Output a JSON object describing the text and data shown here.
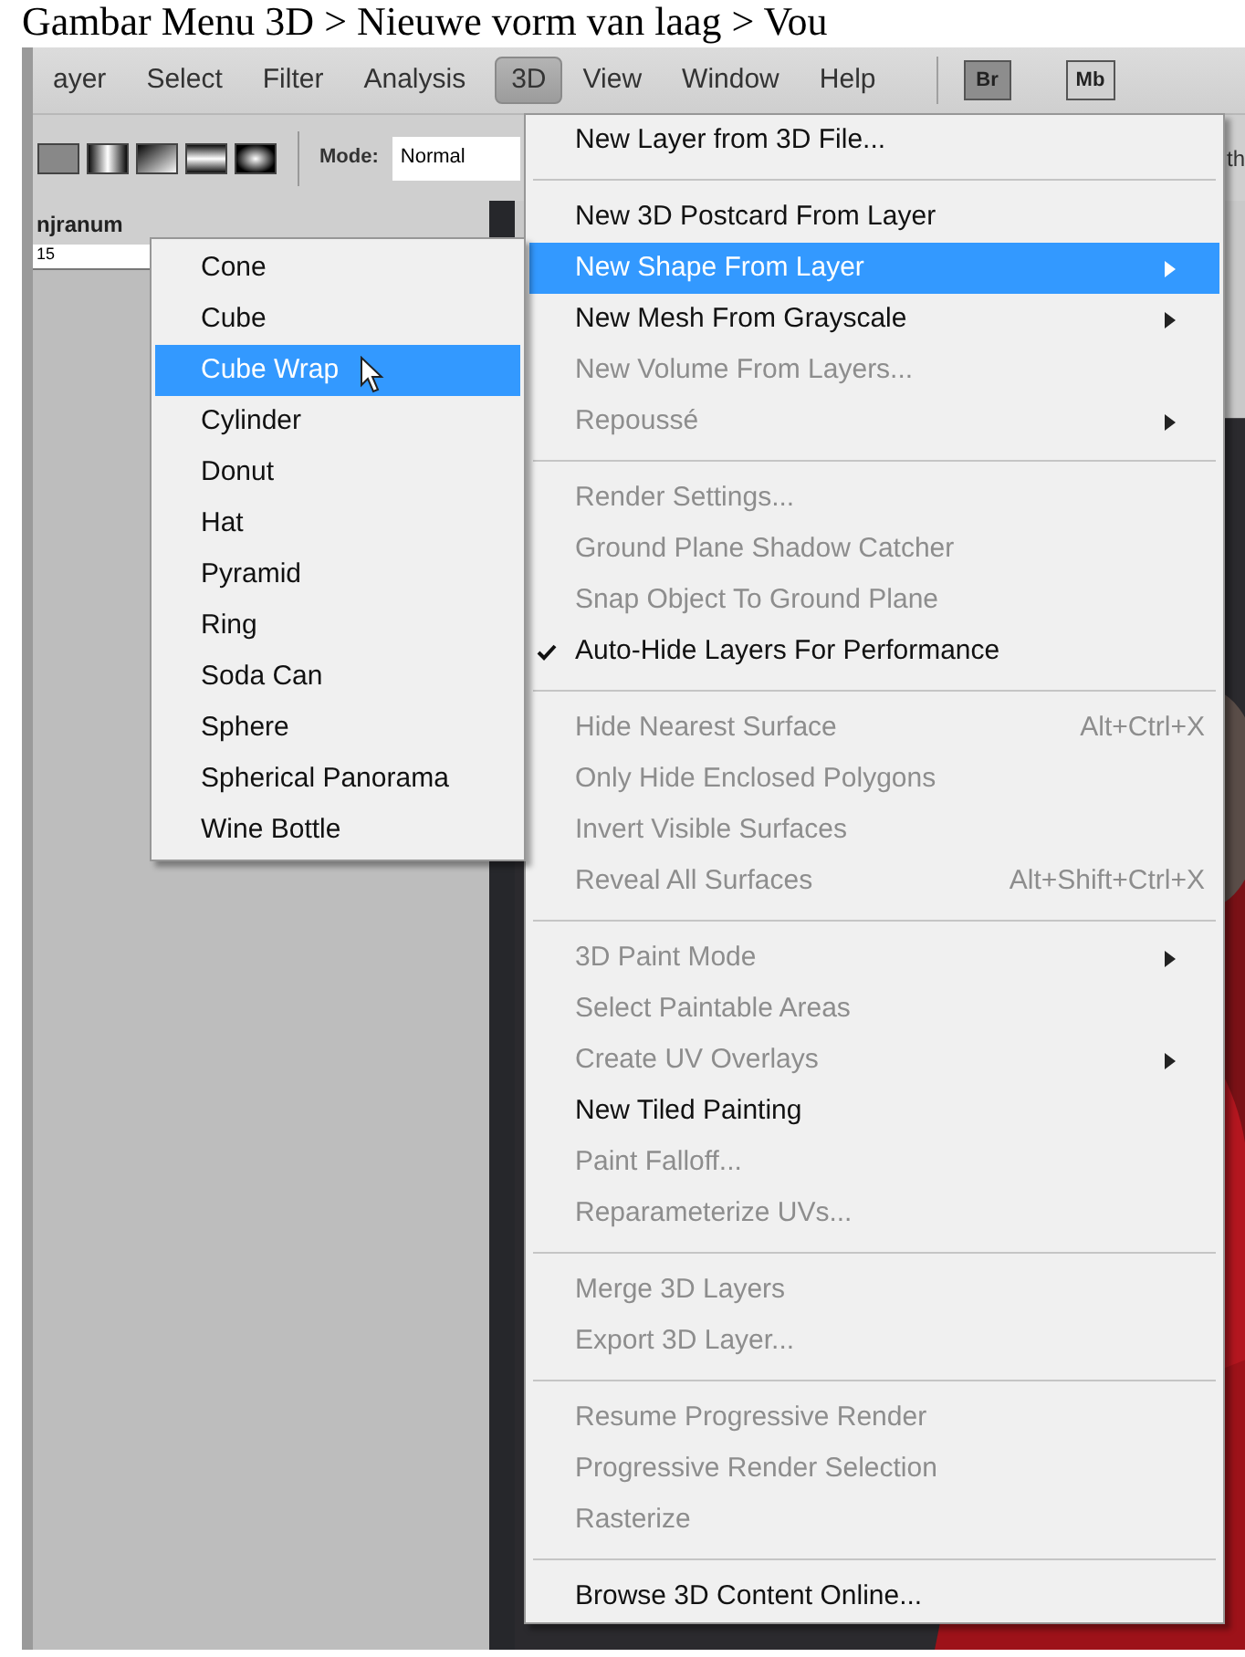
{
  "caption": "Gambar Menu 3D > Nieuwe vorm van laag > Vou",
  "menubar": [
    {
      "label": "ayer",
      "selected": false
    },
    {
      "label": "Select",
      "selected": false
    },
    {
      "label": "Filter",
      "selected": false
    },
    {
      "label": "Analysis",
      "selected": false
    },
    {
      "label": "3D",
      "selected": true
    },
    {
      "label": "View",
      "selected": false
    },
    {
      "label": "Window",
      "selected": false
    },
    {
      "label": "Help",
      "selected": false
    }
  ],
  "app_buttons": [
    "Br",
    "Mb"
  ],
  "toolbar": {
    "mode_label": "Mode:",
    "mode_value": "Normal",
    "cut_label": "th"
  },
  "document": {
    "tab": "njranum",
    "ruler": "15"
  },
  "menu": [
    {
      "kind": "item",
      "label": "New Layer from 3D File...",
      "disabled": false
    },
    {
      "kind": "separator"
    },
    {
      "kind": "item",
      "label": "New 3D Postcard From Layer",
      "disabled": false
    },
    {
      "kind": "item",
      "label": "New Shape From Layer",
      "disabled": false,
      "selected": true,
      "submenu": true
    },
    {
      "kind": "item",
      "label": "New Mesh From Grayscale",
      "disabled": false,
      "submenu": true
    },
    {
      "kind": "item",
      "label": "New Volume From Layers...",
      "disabled": true
    },
    {
      "kind": "item",
      "label": "Repoussé",
      "disabled": true,
      "submenu": true
    },
    {
      "kind": "separator"
    },
    {
      "kind": "item",
      "label": "Render Settings...",
      "disabled": true
    },
    {
      "kind": "item",
      "label": "Ground Plane Shadow Catcher",
      "disabled": true
    },
    {
      "kind": "item",
      "label": "Snap Object To Ground Plane",
      "disabled": true
    },
    {
      "kind": "item",
      "label": "Auto-Hide Layers For Performance",
      "disabled": false,
      "checked": true
    },
    {
      "kind": "separator"
    },
    {
      "kind": "item",
      "label": "Hide Nearest Surface",
      "disabled": true,
      "shortcut": "Alt+Ctrl+X"
    },
    {
      "kind": "item",
      "label": "Only Hide Enclosed Polygons",
      "disabled": true
    },
    {
      "kind": "item",
      "label": "Invert Visible Surfaces",
      "disabled": true
    },
    {
      "kind": "item",
      "label": "Reveal All Surfaces",
      "disabled": true,
      "shortcut": "Alt+Shift+Ctrl+X"
    },
    {
      "kind": "separator"
    },
    {
      "kind": "item",
      "label": "3D Paint Mode",
      "disabled": true,
      "submenu": true
    },
    {
      "kind": "item",
      "label": "Select Paintable Areas",
      "disabled": true
    },
    {
      "kind": "item",
      "label": "Create UV Overlays",
      "disabled": true,
      "submenu": true
    },
    {
      "kind": "item",
      "label": "New Tiled Painting",
      "disabled": false
    },
    {
      "kind": "item",
      "label": "Paint Falloff...",
      "disabled": true
    },
    {
      "kind": "item",
      "label": "Reparameterize UVs...",
      "disabled": true
    },
    {
      "kind": "separator"
    },
    {
      "kind": "item",
      "label": "Merge 3D Layers",
      "disabled": true
    },
    {
      "kind": "item",
      "label": "Export 3D Layer...",
      "disabled": true
    },
    {
      "kind": "separator"
    },
    {
      "kind": "item",
      "label": "Resume Progressive Render",
      "disabled": true
    },
    {
      "kind": "item",
      "label": "Progressive Render Selection",
      "disabled": true
    },
    {
      "kind": "item",
      "label": "Rasterize",
      "disabled": true
    },
    {
      "kind": "separator"
    },
    {
      "kind": "item",
      "label": "Browse 3D Content Online...",
      "disabled": false
    }
  ],
  "submenu": [
    {
      "label": "Cone",
      "selected": false
    },
    {
      "label": "Cube",
      "selected": false
    },
    {
      "label": "Cube Wrap",
      "selected": true
    },
    {
      "label": "Cylinder",
      "selected": false
    },
    {
      "label": "Donut",
      "selected": false
    },
    {
      "label": "Hat",
      "selected": false
    },
    {
      "label": "Pyramid",
      "selected": false
    },
    {
      "label": "Ring",
      "selected": false
    },
    {
      "label": "Soda Can",
      "selected": false
    },
    {
      "label": "Sphere",
      "selected": false
    },
    {
      "label": "Spherical Panorama",
      "selected": false
    },
    {
      "label": "Wine Bottle",
      "selected": false
    }
  ]
}
